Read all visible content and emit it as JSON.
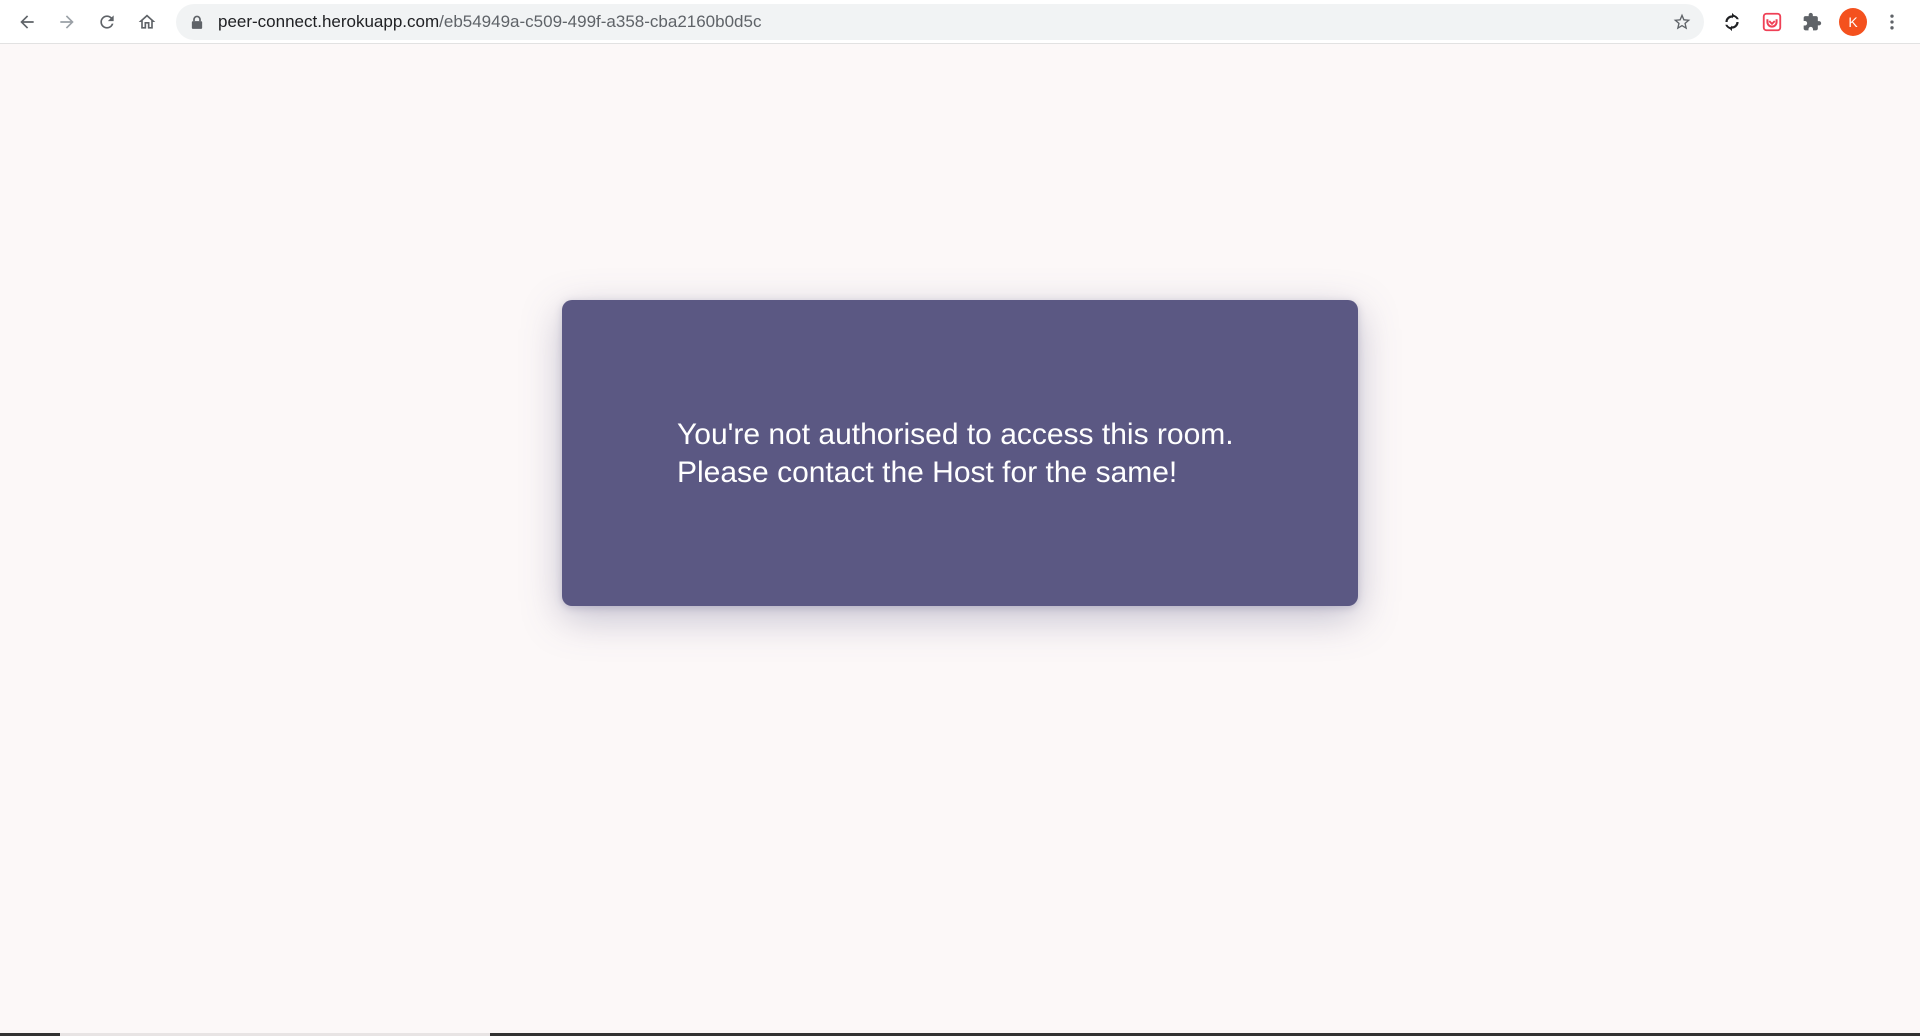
{
  "browser": {
    "url_host": "peer-connect.herokuapp.com",
    "url_path": "/eb54949a-c509-499f-a358-cba2160b0d5c",
    "profile_initial": "K",
    "icons": {
      "back": "arrow-left-icon",
      "forward": "arrow-right-icon",
      "reload": "reload-icon",
      "home": "home-icon",
      "lock": "lock-icon",
      "bookmark": "star-icon",
      "extension_sync": "sync-icon",
      "extension_pocket": "pocket-icon",
      "extensions": "puzzle-icon",
      "menu": "kebab-menu-icon"
    },
    "colors": {
      "avatar": "#f4511e",
      "pocket": "#ef4056"
    }
  },
  "page": {
    "message_line1": "You're not authorised to access this room.",
    "message_line2": "Please contact the Host for the same!",
    "colors": {
      "background": "#fcf8f8",
      "card": "#5b5883",
      "text": "#ffffff"
    }
  }
}
